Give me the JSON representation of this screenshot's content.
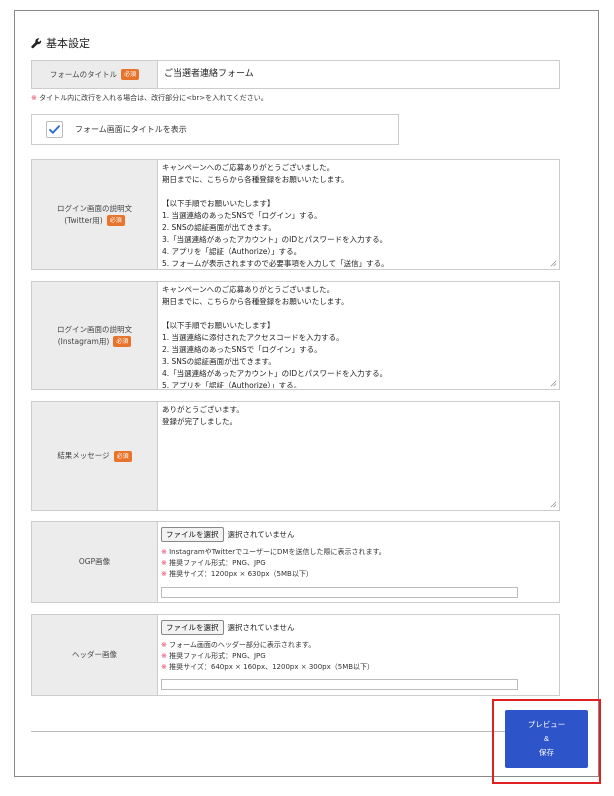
{
  "section": {
    "title": "基本設定",
    "icon": "wrench-icon"
  },
  "required_badge": "必須",
  "form_title": {
    "label": "フォームのタイトル",
    "value": "ご当選者連絡フォーム"
  },
  "title_note": {
    "mark": "※",
    "text": " タイトル内に改行を入れる場合は、改行部分に<br>を入れてください。"
  },
  "show_title_checkbox": {
    "label": "フォーム画面にタイトルを表示",
    "checked": true
  },
  "twitter_login_desc": {
    "label_line1": "ログイン画面の説明文",
    "label_line2": "(Twitter用)",
    "value": "キャンペーンへのご応募ありがとうございました。\n期日までに、こちらから各種登録をお願いいたします。\n\n【以下手順でお願いいたします】\n1. 当選連絡のあったSNSで「ログイン」する。\n2. SNSの認証画面が出てきます。\n3.「当選連絡があったアカウント」のIDとパスワードを入力する。\n4. アプリを「認証（Authorize）」する。\n5. フォームが表示されますので必要事項を入力して「送信」する。"
  },
  "instagram_login_desc": {
    "label_line1": "ログイン画面の説明文",
    "label_line2": "(Instagram用)",
    "value": "キャンペーンへのご応募ありがとうございました。\n期日までに、こちらから各種登録をお願いいたします。\n\n【以下手順でお願いいたします】\n1. 当選連絡に添付されたアクセスコードを入力する。\n2. 当選連絡のあったSNSで「ログイン」する。\n3. SNSの認証画面が出てきます。\n4.「当選連絡があったアカウント」のIDとパスワードを入力する。\n5. アプリを「認証（Authorize）」する。"
  },
  "result_message": {
    "label": "結果メッセージ",
    "value": "ありがとうございます。\n登録が完了しました。"
  },
  "ogp_image": {
    "label": "OGP画像",
    "button": "ファイルを選択",
    "status": "選択されていません",
    "notes": [
      {
        "mark": "※",
        "text": " InstagramやTwitterでユーザーにDMを送信した際に表示されます。"
      },
      {
        "mark": "※",
        "text": " 推奨ファイル形式：PNG、JPG"
      },
      {
        "mark": "※",
        "text": " 推奨サイズ：1200px × 630px（5MB以下）"
      }
    ]
  },
  "header_image": {
    "label": "ヘッダー画像",
    "button": "ファイルを選択",
    "status": "選択されていません",
    "notes": [
      {
        "mark": "※",
        "text": " フォーム画面のヘッダー部分に表示されます。"
      },
      {
        "mark": "※",
        "text": " 推奨ファイル形式：PNG、JPG"
      },
      {
        "mark": "※",
        "text": " 推奨サイズ：640px × 160px、1200px × 300px（5MB以下）"
      }
    ]
  },
  "save_button": {
    "line1": "プレビュー",
    "line2": "&",
    "line3": "保存"
  },
  "colors": {
    "badge": "#e8732a",
    "accent": "#2d55c9",
    "highlight": "#e02020",
    "note_mark": "#e0325a"
  }
}
